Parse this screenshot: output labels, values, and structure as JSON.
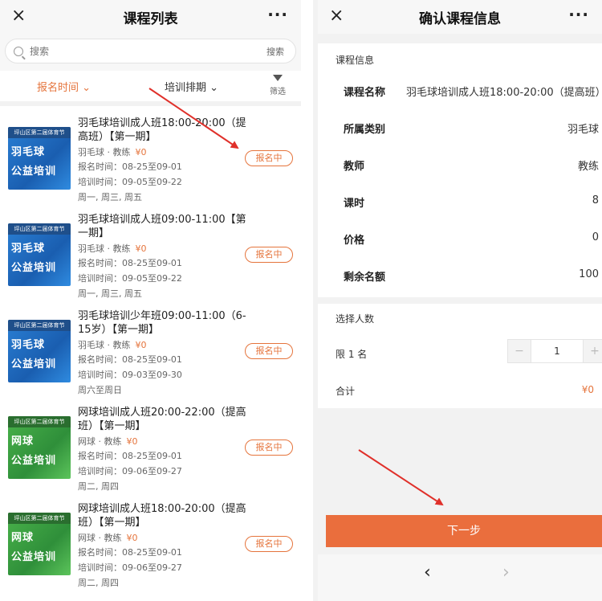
{
  "left": {
    "title": "课程列表",
    "close_icon": "×",
    "more_icon": "···",
    "search": {
      "placeholder": "搜索",
      "button": "搜索"
    },
    "filters": {
      "time": "报名时间",
      "schedule": "培训排期",
      "filter": "筛选"
    },
    "courses": [
      {
        "name": "羽毛球培训成人班18:00-20:00（提高班）【第一期】",
        "category": "羽毛球",
        "teacher": "教练",
        "price": "¥0",
        "signup": "报名时间：08-25至09-01",
        "train": "培训时间：09-05至09-22",
        "days": "周一, 周三, 周五",
        "status": "报名中",
        "thumb": {
          "band": "坪山区第二届体育节",
          "l1": "羽毛球",
          "l2": "公益培训",
          "color": "blue"
        }
      },
      {
        "name": "羽毛球培训成人班09:00-11:00【第一期】",
        "category": "羽毛球",
        "teacher": "教练",
        "price": "¥0",
        "signup": "报名时间：08-25至09-01",
        "train": "培训时间：09-05至09-22",
        "days": "周一, 周三, 周五",
        "status": "报名中",
        "thumb": {
          "band": "坪山区第二届体育节",
          "l1": "羽毛球",
          "l2": "公益培训",
          "color": "blue"
        }
      },
      {
        "name": "羽毛球培训少年班09:00-11:00（6-15岁）【第一期】",
        "category": "羽毛球",
        "teacher": "教练",
        "price": "¥0",
        "signup": "报名时间：08-25至09-01",
        "train": "培训时间：09-03至09-30",
        "days": "周六至周日",
        "status": "报名中",
        "thumb": {
          "band": "坪山区第二届体育节",
          "l1": "羽毛球",
          "l2": "公益培训",
          "color": "blue"
        }
      },
      {
        "name": "网球培训成人班20:00-22:00（提高班）【第一期】",
        "category": "网球",
        "teacher": "教练",
        "price": "¥0",
        "signup": "报名时间：08-25至09-01",
        "train": "培训时间：09-06至09-27",
        "days": "周二, 周四",
        "status": "报名中",
        "thumb": {
          "band": "坪山区第二届体育节",
          "l1": "网球",
          "l2": "公益培训",
          "color": "green"
        }
      },
      {
        "name": "网球培训成人班18:00-20:00（提高班）【第一期】",
        "category": "网球",
        "teacher": "教练",
        "price": "¥0",
        "signup": "报名时间：08-25至09-01",
        "train": "培训时间：09-06至09-27",
        "days": "周二, 周四",
        "status": "报名中",
        "thumb": {
          "band": "坪山区第二届体育节",
          "l1": "网球",
          "l2": "公益培训",
          "color": "green"
        }
      }
    ]
  },
  "right": {
    "title": "确认课程信息",
    "close_icon": "×",
    "more_icon": "···",
    "section_course": "课程信息",
    "rows": [
      {
        "label": "课程名称",
        "value": "羽毛球培训成人班18:00-20:00（提高班）"
      },
      {
        "label": "所属类别",
        "value": "羽毛球"
      },
      {
        "label": "教师",
        "value": "教练"
      },
      {
        "label": "课时",
        "value": "8"
      },
      {
        "label": "价格",
        "value": "0"
      },
      {
        "label": "剩余名额",
        "value": "100"
      }
    ],
    "section_people": "选择人数",
    "limit": "限 1 名",
    "stepper": {
      "minus": "−",
      "value": "1",
      "plus": "+"
    },
    "total_label": "合计",
    "total_value": "¥0",
    "next_button": "下一步",
    "nav": {
      "back": "‹",
      "forward": "›"
    }
  },
  "colors": {
    "accent": "#e5743c",
    "button": "#ea6e3d",
    "arrow": "#e0302a"
  }
}
